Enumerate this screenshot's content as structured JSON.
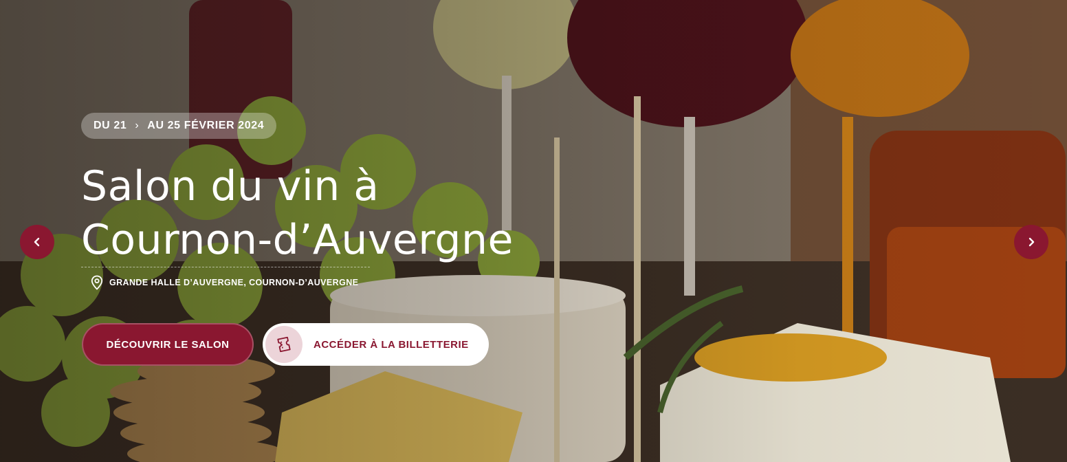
{
  "hero": {
    "date_start": "DU 21",
    "date_end": "AU 25 FÉVRIER 2024",
    "title_line1": "Salon du vin à",
    "title_line2": "Cournon-d’Auvergne",
    "location": "GRANDE HALLE D’AUVERGNE, COURNON-D’AUVERGNE",
    "primary_button": "DÉCOUVRIR LE SALON",
    "secondary_button": "ACCÉDER À LA BILLETTERIE"
  },
  "icons": {
    "date_separator": "chevron-right-icon",
    "location": "map-pin-icon",
    "ticket": "ticket-icon",
    "prev": "chevron-left-icon",
    "next": "chevron-right-icon"
  },
  "colors": {
    "accent": "#8a1730",
    "ticket_circle": "#ecd4d9",
    "text_light": "#ffffff"
  }
}
